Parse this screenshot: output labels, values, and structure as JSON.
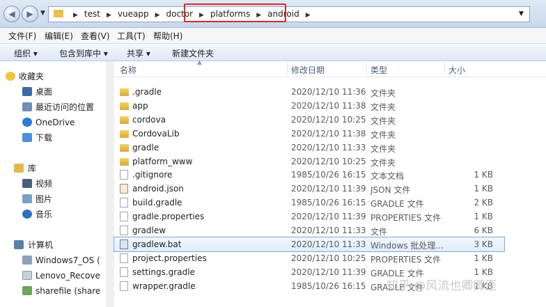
{
  "address": {
    "crumbs": [
      "test",
      "vueapp",
      "doctor",
      "platforms",
      "android"
    ]
  },
  "menu": [
    "文件(F)",
    "编辑(E)",
    "查看(V)",
    "工具(T)",
    "帮助(H)"
  ],
  "toolbar": {
    "organize": "组织 ▾",
    "include": "包含到库中 ▾",
    "share": "共享 ▾",
    "new_folder": "新建文件夹"
  },
  "nav": {
    "favorites": "收藏夹",
    "desktop": "桌面",
    "recent": "最近访问的位置",
    "onedrive": "OneDrive",
    "downloads": "下载",
    "libraries": "库",
    "videos": "视频",
    "pictures": "图片",
    "music": "音乐",
    "computer": "计算机",
    "drive_c": "Windows7_OS (",
    "drive_d": "Lenovo_Recove",
    "drive_share": "sharefile (share"
  },
  "columns": {
    "name": "名称",
    "date": "修改日期",
    "type": "类型",
    "size": "大小"
  },
  "files": [
    {
      "name": ".gradle",
      "date": "2020/12/10 11:36",
      "type": "文件夹",
      "size": "",
      "kind": "folder"
    },
    {
      "name": "app",
      "date": "2020/12/10 11:38",
      "type": "文件夹",
      "size": "",
      "kind": "folder"
    },
    {
      "name": "cordova",
      "date": "2020/12/10 10:25",
      "type": "文件夹",
      "size": "",
      "kind": "folder"
    },
    {
      "name": "CordovaLib",
      "date": "2020/12/10 11:38",
      "type": "文件夹",
      "size": "",
      "kind": "folder"
    },
    {
      "name": "gradle",
      "date": "2020/12/10 11:33",
      "type": "文件夹",
      "size": "",
      "kind": "folder"
    },
    {
      "name": "platform_www",
      "date": "2020/12/10 10:25",
      "type": "文件夹",
      "size": "",
      "kind": "folder"
    },
    {
      "name": ".gitignore",
      "date": "1985/10/26 16:15",
      "type": "文本文档",
      "size": "1 KB",
      "kind": "file"
    },
    {
      "name": "android.json",
      "date": "2020/12/10 11:39",
      "type": "JSON 文件",
      "size": "1 KB",
      "kind": "json"
    },
    {
      "name": "build.gradle",
      "date": "1985/10/26 16:15",
      "type": "GRADLE 文件",
      "size": "2 KB",
      "kind": "file"
    },
    {
      "name": "gradle.properties",
      "date": "2020/12/10 11:39",
      "type": "PROPERTIES 文件",
      "size": "1 KB",
      "kind": "file"
    },
    {
      "name": "gradlew",
      "date": "2020/12/10 11:33",
      "type": "文件",
      "size": "6 KB",
      "kind": "file"
    },
    {
      "name": "gradlew.bat",
      "date": "2020/12/10 11:33",
      "type": "Windows 批处理...",
      "size": "3 KB",
      "kind": "bat"
    },
    {
      "name": "project.properties",
      "date": "2020/12/10 10:25",
      "type": "PROPERTIES 文件",
      "size": "1 KB",
      "kind": "file"
    },
    {
      "name": "settings.gradle",
      "date": "2020/12/10 11:39",
      "type": "GRADLE 文件",
      "size": "1 KB",
      "kind": "file"
    },
    {
      "name": "wrapper.gradle",
      "date": "1985/10/26 16:15",
      "type": "GRADLE 文件",
      "size": "1 KB",
      "kind": "file"
    }
  ],
  "watermark": "知乎 @风流也卿卿歪"
}
